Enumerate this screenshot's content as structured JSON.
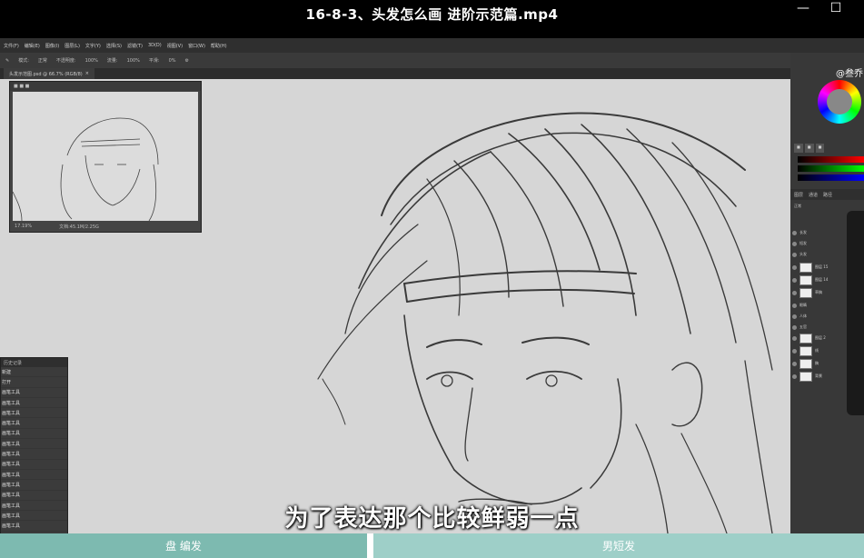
{
  "window": {
    "title": "16-8-3、头发怎么画 进阶示范篇.mp4",
    "minimize_glyph": "—",
    "maximize_glyph": "☐"
  },
  "app": {
    "menus": [
      "文件(F)",
      "编辑(E)",
      "图像(I)",
      "图层(L)",
      "文字(Y)",
      "选择(S)",
      "滤镜(T)",
      "3D(D)",
      "视图(V)",
      "窗口(W)",
      "帮助(H)"
    ],
    "options": [
      "模式:",
      "正常",
      "不透明度:",
      "100%",
      "流量:",
      "100%",
      "平滑:",
      "0%"
    ],
    "doc_tab": "头发示范图.psd @ 66.7% (RGB/8)"
  },
  "navigator": {
    "zoom": "17.19%",
    "doc_size": "文档:45.1M/2.25G"
  },
  "history": {
    "title": "历史记录",
    "items": [
      "新建",
      "打开",
      "画笔工具",
      "画笔工具",
      "画笔工具",
      "画笔工具",
      "画笔工具",
      "画笔工具",
      "画笔工具",
      "画笔工具",
      "画笔工具",
      "画笔工具",
      "画笔工具",
      "画笔工具",
      "画笔工具",
      "画笔工具"
    ]
  },
  "layers": {
    "tabs": [
      "图层",
      "通道",
      "路径"
    ],
    "blend": "正常",
    "rows": [
      "长发",
      "短发",
      "头发",
      "图层 15",
      "图层 14",
      "草稿",
      "眼睛",
      "人体",
      "五官",
      "图层 2",
      "线",
      "稿",
      "背景"
    ]
  },
  "colors": {
    "accent_bar": "#7dbab0",
    "bottom_bar": "#9ecfc8",
    "canvas": "#d6d6d6"
  },
  "subtitle": "为了表达那个比较鲜弱一点",
  "watermark": "@叁乔",
  "chapters": [
    {
      "label": "盘 编发"
    },
    {
      "label": "男短发"
    }
  ]
}
